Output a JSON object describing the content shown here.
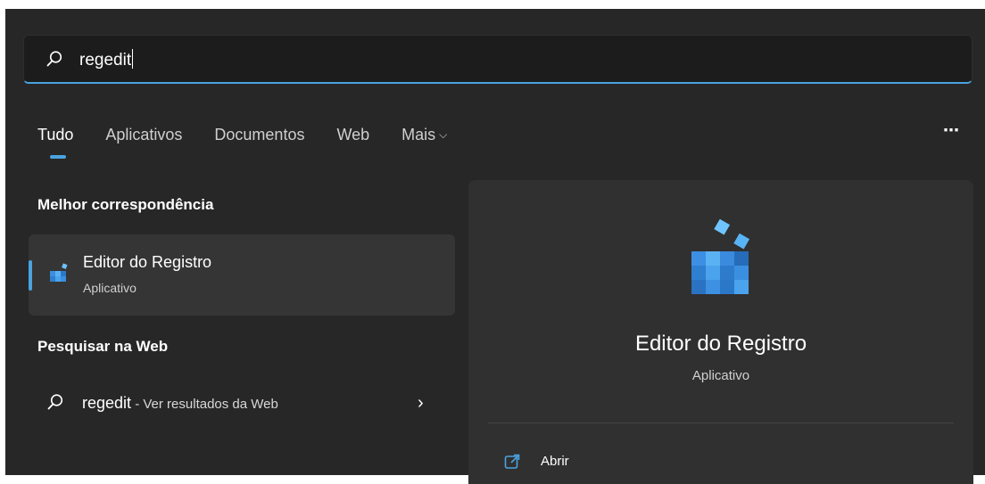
{
  "search": {
    "query": "regedit"
  },
  "tabs": [
    {
      "label": "Tudo"
    },
    {
      "label": "Aplicativos"
    },
    {
      "label": "Documentos"
    },
    {
      "label": "Web"
    },
    {
      "label": "Mais"
    }
  ],
  "more_icon": "⋯",
  "best_match": {
    "section_title": "Melhor correspondência",
    "name": "Editor do Registro",
    "type": "Aplicativo",
    "icon": "registry-editor-icon"
  },
  "web_search": {
    "section_title": "Pesquisar na Web",
    "query": "regedit",
    "suffix": " - Ver resultados da Web"
  },
  "detail": {
    "title": "Editor do Registro",
    "subtitle": "Aplicativo",
    "actions": [
      {
        "label": "Abrir",
        "icon": "open-icon"
      }
    ]
  },
  "colors": {
    "accent": "#4aa3df",
    "background": "#272727",
    "panel": "#303030"
  }
}
